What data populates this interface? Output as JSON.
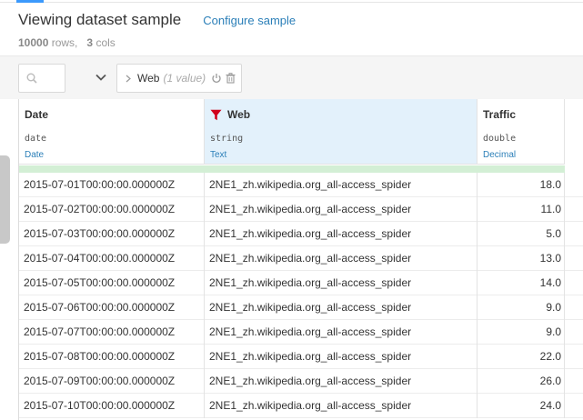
{
  "header": {
    "title": "Viewing dataset sample",
    "configure_link": "Configure sample"
  },
  "stats": {
    "rows_count": "10000",
    "rows_label": "rows,",
    "cols_count": "3",
    "cols_label": "cols"
  },
  "filter": {
    "facet_name": "Web",
    "facet_count": "(1 value)"
  },
  "colors": {
    "accent": "#3b99fc",
    "link": "#2b7fb8",
    "filter_icon": "#d0021b",
    "selected_column": "#e3f1fb",
    "quality_ok": "#d3efd5"
  },
  "columns": [
    {
      "name": "Date",
      "type": "date",
      "meaning": "Date",
      "filtered": false
    },
    {
      "name": "Web",
      "type": "string",
      "meaning": "Text",
      "filtered": true
    },
    {
      "name": "Traffic",
      "type": "double",
      "meaning": "Decimal",
      "filtered": false
    }
  ],
  "rows": [
    [
      "2015-07-01T00:00:00.000000Z",
      "2NE1_zh.wikipedia.org_all-access_spider",
      "18.0"
    ],
    [
      "2015-07-02T00:00:00.000000Z",
      "2NE1_zh.wikipedia.org_all-access_spider",
      "11.0"
    ],
    [
      "2015-07-03T00:00:00.000000Z",
      "2NE1_zh.wikipedia.org_all-access_spider",
      "5.0"
    ],
    [
      "2015-07-04T00:00:00.000000Z",
      "2NE1_zh.wikipedia.org_all-access_spider",
      "13.0"
    ],
    [
      "2015-07-05T00:00:00.000000Z",
      "2NE1_zh.wikipedia.org_all-access_spider",
      "14.0"
    ],
    [
      "2015-07-06T00:00:00.000000Z",
      "2NE1_zh.wikipedia.org_all-access_spider",
      "9.0"
    ],
    [
      "2015-07-07T00:00:00.000000Z",
      "2NE1_zh.wikipedia.org_all-access_spider",
      "9.0"
    ],
    [
      "2015-07-08T00:00:00.000000Z",
      "2NE1_zh.wikipedia.org_all-access_spider",
      "22.0"
    ],
    [
      "2015-07-09T00:00:00.000000Z",
      "2NE1_zh.wikipedia.org_all-access_spider",
      "26.0"
    ],
    [
      "2015-07-10T00:00:00.000000Z",
      "2NE1_zh.wikipedia.org_all-access_spider",
      "24.0"
    ]
  ]
}
